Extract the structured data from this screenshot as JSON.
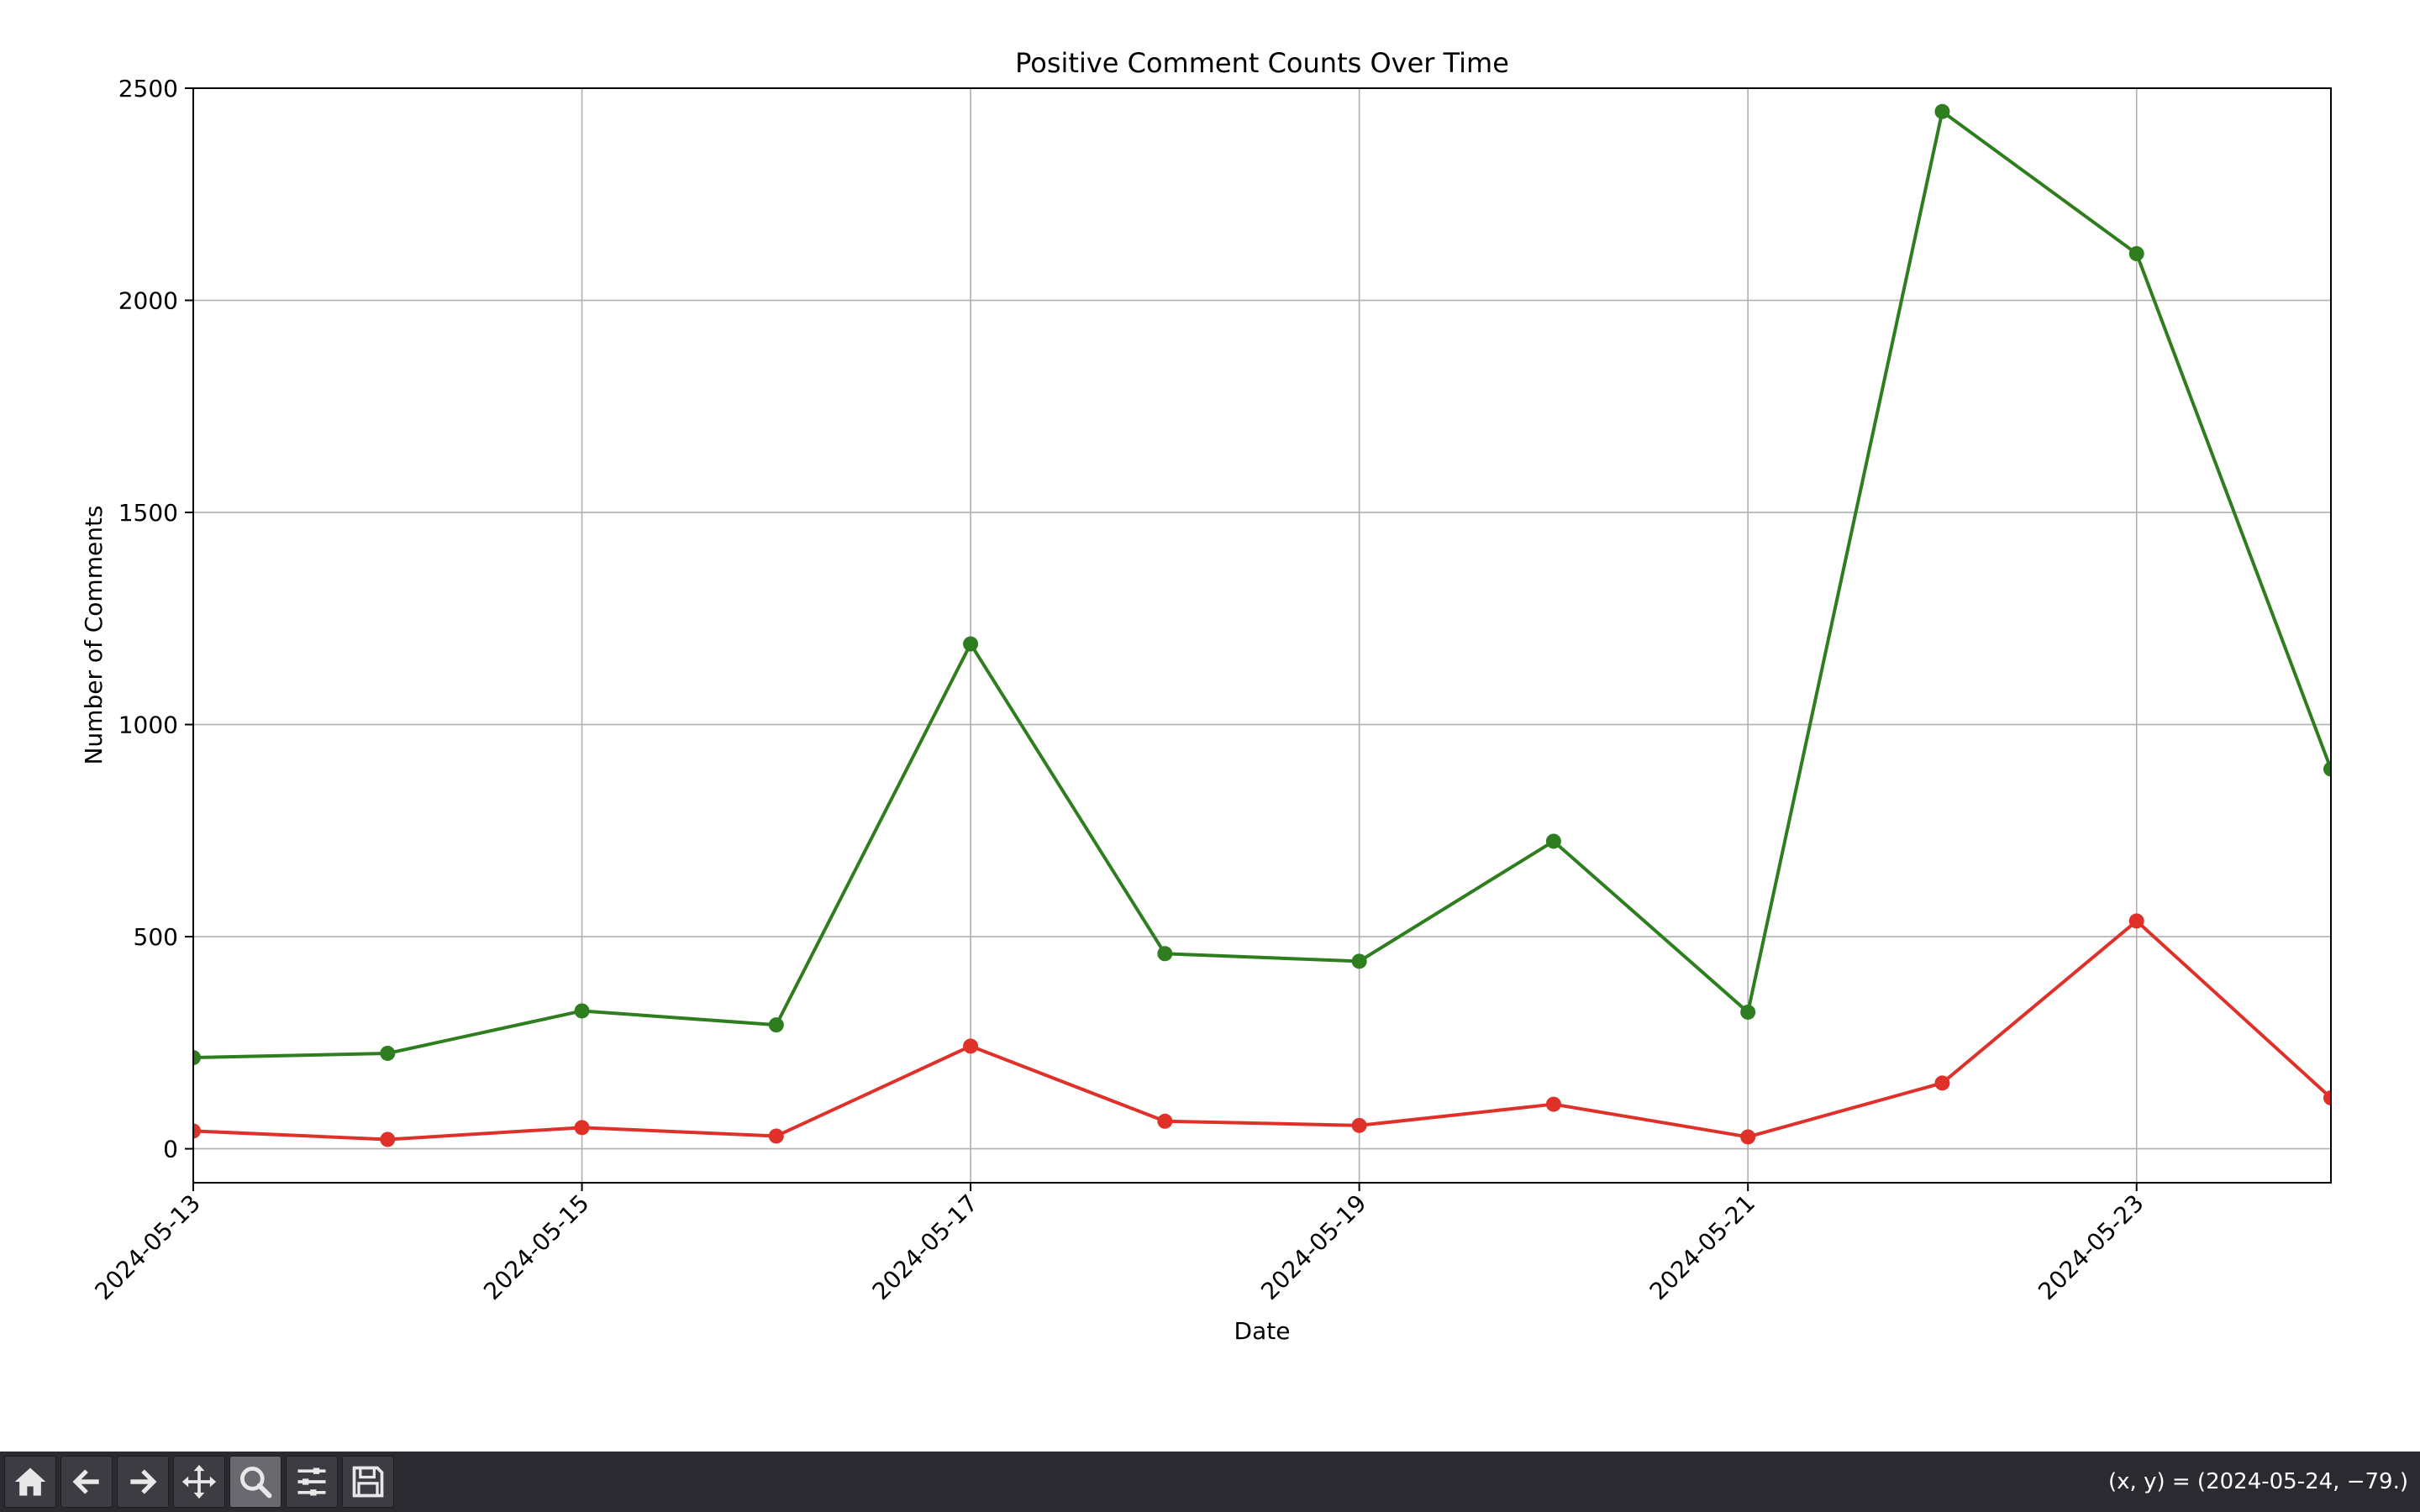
{
  "window": {
    "coords_readout": "(x, y) = (2024-05-24, −79.)"
  },
  "toolbar": {
    "buttons": [
      {
        "icon": "home-icon"
      },
      {
        "icon": "back-arrow-icon"
      },
      {
        "icon": "forward-arrow-icon"
      },
      {
        "icon": "pan-move-icon"
      },
      {
        "icon": "zoom-magnifier-icon",
        "active": true
      },
      {
        "icon": "configure-subplots-icon"
      },
      {
        "icon": "save-floppy-icon"
      }
    ]
  },
  "chart_data": {
    "type": "line",
    "title": "Positive Comment Counts Over Time",
    "xlabel": "Date",
    "ylabel": "Number of Comments",
    "x": [
      "2024-05-13",
      "2024-05-14",
      "2024-05-15",
      "2024-05-16",
      "2024-05-17",
      "2024-05-18",
      "2024-05-19",
      "2024-05-20",
      "2024-05-21",
      "2024-05-22",
      "2024-05-23",
      "2024-05-24"
    ],
    "xlim": [
      "2024-05-13",
      "2024-05-24"
    ],
    "x_ticks": [
      "2024-05-13",
      "2024-05-15",
      "2024-05-17",
      "2024-05-19",
      "2024-05-21",
      "2024-05-23"
    ],
    "ylim": [
      -80,
      2500
    ],
    "y_ticks": [
      0,
      500,
      1000,
      1500,
      2000,
      2500
    ],
    "grid": true,
    "series": [
      {
        "color": "#2e7d1e",
        "marker": "circle",
        "values": [
          215,
          225,
          325,
          292,
          1190,
          460,
          442,
          725,
          322,
          2445,
          2110,
          895
        ]
      },
      {
        "color": "#e0302a",
        "marker": "circle",
        "values": [
          42,
          22,
          50,
          30,
          242,
          65,
          55,
          105,
          28,
          155,
          537,
          120
        ]
      }
    ]
  }
}
